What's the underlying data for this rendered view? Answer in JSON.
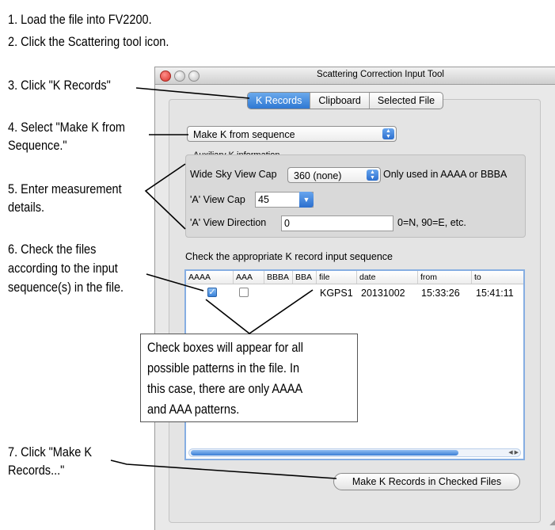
{
  "instructions": {
    "step1": "1. Load the file into FV2200.",
    "step2": "2. Click the Scattering tool icon.",
    "step3": "3. Click \"K Records\"",
    "step4_line1": "4. Select \"Make K from",
    "step4_line2": "Sequence.\"",
    "step5_line1": "5. Enter measurement",
    "step5_line2": "details.",
    "step6_line1": "6. Check the files",
    "step6_line2": "according to the input",
    "step6_line3": "sequence(s) in the file.",
    "step7_line1": "7. Click \"Make K",
    "step7_line2": "Records...\""
  },
  "window": {
    "title": "Scattering Correction Input Tool",
    "tabs": [
      "K Records",
      "Clipboard",
      "Selected File"
    ],
    "selected_tab": "K Records",
    "mode_popup": "Make K from sequence",
    "aux_label": "Auxiliary K information",
    "wide_sky_label": "Wide Sky View Cap",
    "wide_sky_value": "360 (none)",
    "wide_sky_note": "Only used in AAAA or BBBA",
    "a_view_cap_label": "'A' View Cap",
    "a_view_cap_value": "45",
    "a_view_dir_label": "'A' View Direction",
    "a_view_dir_value": "0",
    "a_view_dir_note": "0=N, 90=E, etc.",
    "sequence_label": "Check the appropriate K record input sequence",
    "columns": [
      "AAAA",
      "AAA",
      "BBBA",
      "BBA",
      "file",
      "date",
      "from",
      "to"
    ],
    "row": {
      "aaaa_checked": true,
      "aaa_checked": false,
      "file": "KGPS1",
      "date": "20131002",
      "from": "15:33:26",
      "to": "15:41:11"
    },
    "make_button": "Make K Records in Checked Files"
  },
  "callout": {
    "line1": "Check boxes will appear for all",
    "line2": "possible patterns in the file. In",
    "line3": "this case, there are only AAAA",
    "line4": "and AAA patterns."
  }
}
